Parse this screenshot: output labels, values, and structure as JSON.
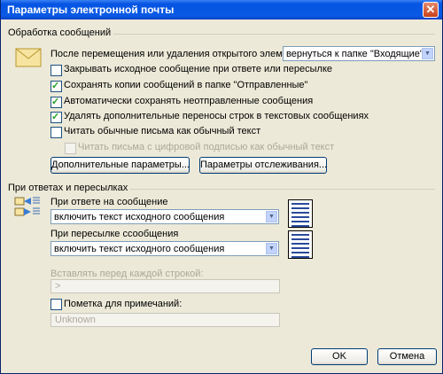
{
  "window": {
    "title": "Параметры электронной почты",
    "close_label": "✕"
  },
  "processing": {
    "group_title": "Обработка сообщений",
    "after_move_label": "После перемещения или удаления открытого элемента:",
    "after_move_value": "вернуться к папке \"Входящие\"",
    "options": [
      {
        "label": "Закрывать исходное сообщение при ответе или пересылке",
        "checked": false,
        "disabled": false
      },
      {
        "label": "Сохранять копии сообщений в папке \"Отправленные\"",
        "checked": true,
        "disabled": false
      },
      {
        "label": "Автоматически сохранять неотправленные сообщения",
        "checked": true,
        "disabled": false
      },
      {
        "label": "Удалять дополнительные переносы строк в текстовых сообщениях",
        "checked": true,
        "disabled": false
      },
      {
        "label": "Читать обычные письма как обычный текст",
        "checked": false,
        "disabled": false
      },
      {
        "label": "Читать письма с цифровой подписью как обычный текст",
        "checked": false,
        "disabled": true
      }
    ],
    "advanced_button": "Дополнительные параметры...",
    "tracking_button": "Параметры отслеживания..."
  },
  "replies": {
    "group_title": "При ответах и пересылках",
    "reply_label": "При ответе на сообщение",
    "reply_value": "включить текст исходного сообщения",
    "forward_label": "При пересылке ссообщения",
    "forward_value": "включить текст исходного сообщения",
    "prefix_label": "Вставлять перед каждой строкой:",
    "prefix_value": ">",
    "mark_label": "Пометка для примечаний:",
    "mark_value": "Unknown"
  },
  "footer": {
    "ok_button": "OK",
    "cancel_button": "Отмена"
  }
}
